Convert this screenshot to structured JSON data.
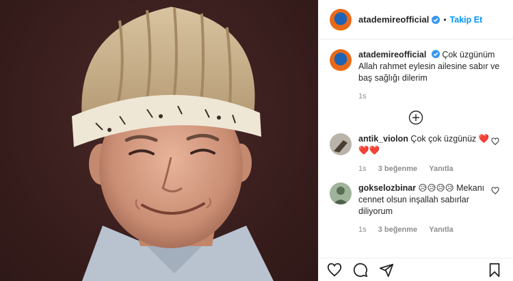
{
  "post": {
    "username": "atademireofficial",
    "follow_label": "Takip Et",
    "dot": "•"
  },
  "caption": {
    "username": "atademireofficial",
    "text": "Çok üzgünüm Allah rahmet eylesin ailesine sabır ve baş sağlığı dilerim",
    "time": "1s"
  },
  "comments": [
    {
      "username": "antik_violon",
      "text": "Çok çok üzgünüz ❤️ ❤️❤️",
      "time": "1s",
      "likes": "3 beğenme",
      "reply": "Yanıtla"
    },
    {
      "username": "gokselozbinar",
      "text": "😥😥😥😥 Mekanı cennet olsun inşallah sabırlar diliyorum",
      "time": "1s",
      "likes": "3 beğenme",
      "reply": "Yanıtla"
    }
  ],
  "colors": {
    "link": "#0095f6",
    "verified": "#3897f0",
    "text": "#262626",
    "muted": "#8e8e8e"
  },
  "icons": [
    "heart-icon",
    "comment-icon",
    "share-icon",
    "bookmark-icon",
    "plus-circle-icon",
    "verified-icon"
  ]
}
